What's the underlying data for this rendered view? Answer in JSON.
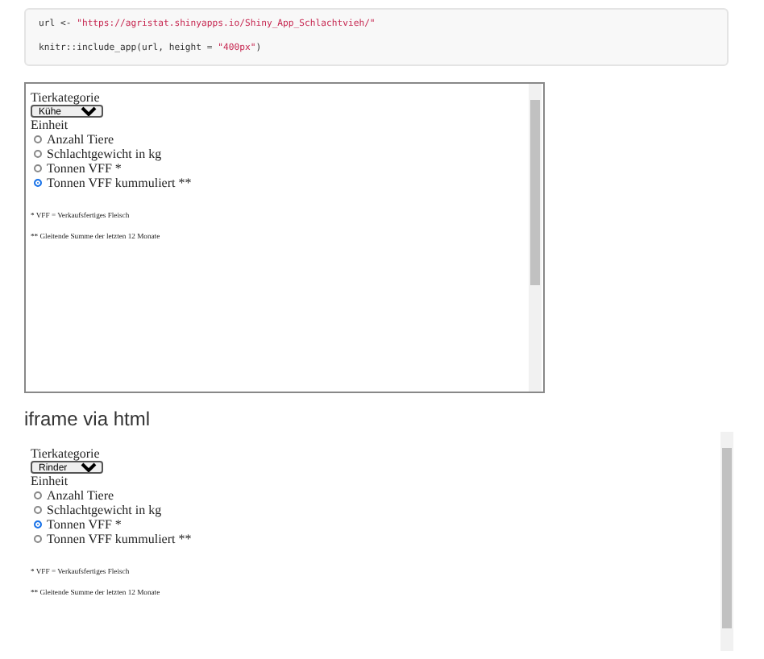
{
  "code": {
    "lines": [
      [
        {
          "kind": "plain",
          "text": "url <- "
        },
        {
          "kind": "string",
          "text": "\"https://agristat.shinyapps.io/Shiny_App_Schlachtvieh/\""
        }
      ],
      [
        {
          "kind": "plain",
          "text": "knitr::include_app(url, height = "
        },
        {
          "kind": "string",
          "text": "\"400px\""
        },
        {
          "kind": "plain",
          "text": ")"
        }
      ]
    ]
  },
  "apps": [
    {
      "kind": "bordered",
      "category_label": "Tierkategorie",
      "category_value": "Kühe",
      "unit_label": "Einheit",
      "options": [
        {
          "label": "Anzahl Tiere",
          "selected": false
        },
        {
          "label": "Schlachtgewicht in kg",
          "selected": false
        },
        {
          "label": "Tonnen VFF *",
          "selected": false
        },
        {
          "label": "Tonnen VFF kummuliert **",
          "selected": true
        }
      ],
      "notes": [
        "* VFF = Verkaufsfertiges Fleisch",
        "** Gleitende Summe der letzten 12 Monate"
      ]
    },
    {
      "kind": "plain",
      "heading": "iframe via html",
      "category_label": "Tierkategorie",
      "category_value": "Rinder",
      "unit_label": "Einheit",
      "options": [
        {
          "label": "Anzahl Tiere",
          "selected": false
        },
        {
          "label": "Schlachtgewicht in kg",
          "selected": false
        },
        {
          "label": "Tonnen VFF *",
          "selected": true
        },
        {
          "label": "Tonnen VFF kummuliert **",
          "selected": false
        }
      ],
      "notes": [
        "* VFF = Verkaufsfertiges Fleisch",
        "** Gleitende Summe der letzten 12 Monate"
      ]
    }
  ]
}
